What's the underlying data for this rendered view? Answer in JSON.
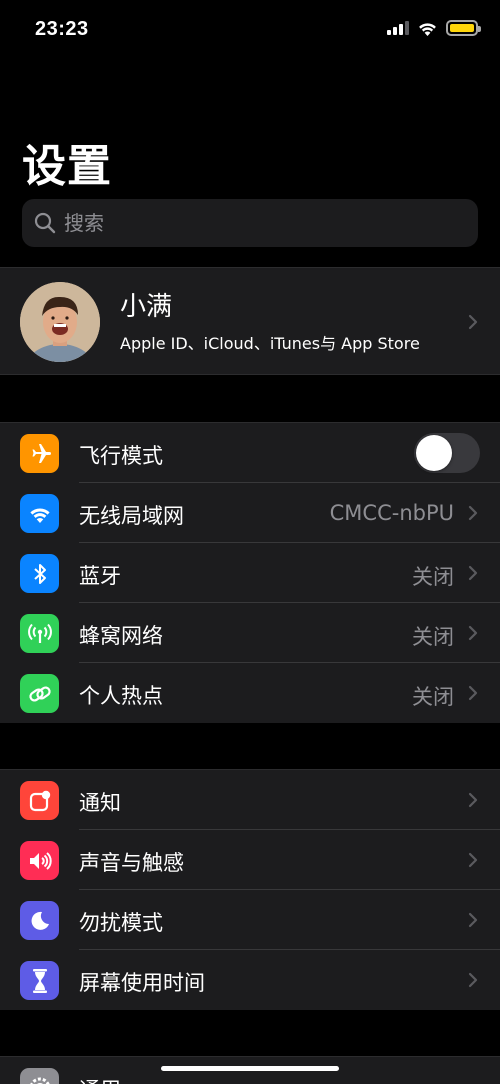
{
  "status_bar": {
    "time": "23:23",
    "battery_color": "#ffd60a"
  },
  "header": {
    "title": "设置"
  },
  "search": {
    "placeholder": "搜索",
    "icon": "search-icon"
  },
  "profile": {
    "name": "小满",
    "subtitle": "Apple ID、iCloud、iTunes与 App Store"
  },
  "groups": [
    {
      "items": [
        {
          "label": "飞行模式",
          "icon": "airplane-icon",
          "color": "#ff9500",
          "toggle": false
        },
        {
          "label": "无线局域网",
          "icon": "wifi-icon",
          "color": "#0a84ff",
          "value": "CMCC-nbPU"
        },
        {
          "label": "蓝牙",
          "icon": "bluetooth-icon",
          "color": "#0a84ff",
          "value": "关闭"
        },
        {
          "label": "蜂窝网络",
          "icon": "cellular-icon",
          "color": "#30d158",
          "value": "关闭"
        },
        {
          "label": "个人热点",
          "icon": "hotspot-icon",
          "color": "#30d158",
          "value": "关闭"
        }
      ]
    },
    {
      "items": [
        {
          "label": "通知",
          "icon": "notifications-icon",
          "color": "#ff453a"
        },
        {
          "label": "声音与触感",
          "icon": "sound-icon",
          "color": "#ff2d55"
        },
        {
          "label": "勿扰模式",
          "icon": "moon-icon",
          "color": "#5e5ce6"
        },
        {
          "label": "屏幕使用时间",
          "icon": "hourglass-icon",
          "color": "#5e5ce6"
        }
      ]
    },
    {
      "items": [
        {
          "label": "通用",
          "icon": "gear-icon",
          "color": "#8e8e93"
        }
      ]
    }
  ]
}
